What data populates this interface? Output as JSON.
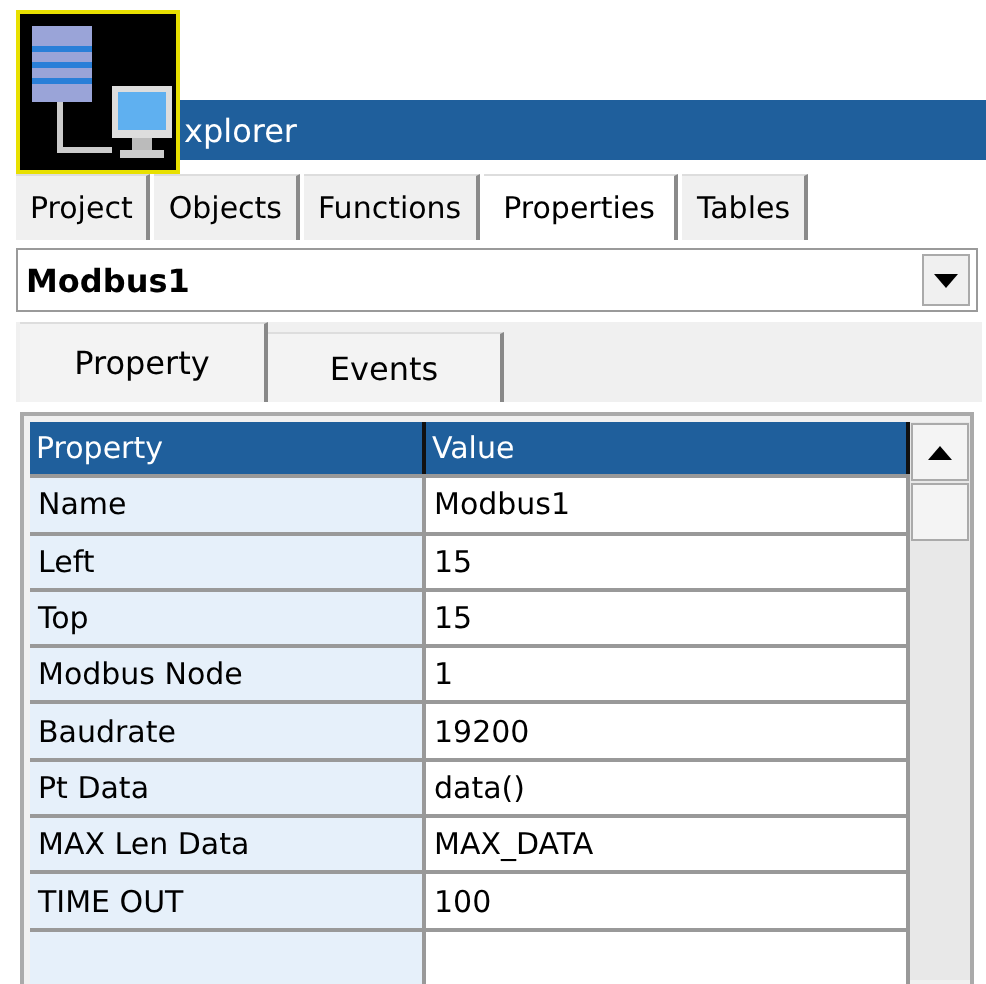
{
  "window": {
    "title": "xplorer"
  },
  "tabs": [
    {
      "label": "Project",
      "selected": false
    },
    {
      "label": "Objects",
      "selected": false
    },
    {
      "label": "Functions",
      "selected": false
    },
    {
      "label": "Properties",
      "selected": true
    },
    {
      "label": "Tables",
      "selected": false
    }
  ],
  "object_selector": {
    "value": "Modbus1"
  },
  "subtabs": [
    {
      "label": "Property",
      "selected": true
    },
    {
      "label": "Events",
      "selected": false
    }
  ],
  "grid": {
    "columns": [
      "Property",
      "Value"
    ],
    "rows": [
      {
        "property": "Name",
        "value": "Modbus1"
      },
      {
        "property": "Left",
        "value": "15"
      },
      {
        "property": "Top",
        "value": "15"
      },
      {
        "property": "Modbus Node",
        "value": "1"
      },
      {
        "property": "Baudrate",
        "value": "19200"
      },
      {
        "property": "Pt Data",
        "value": "data()"
      },
      {
        "property": "MAX Len Data",
        "value": "MAX_DATA"
      },
      {
        "property": "TIME OUT",
        "value": "100"
      }
    ]
  }
}
